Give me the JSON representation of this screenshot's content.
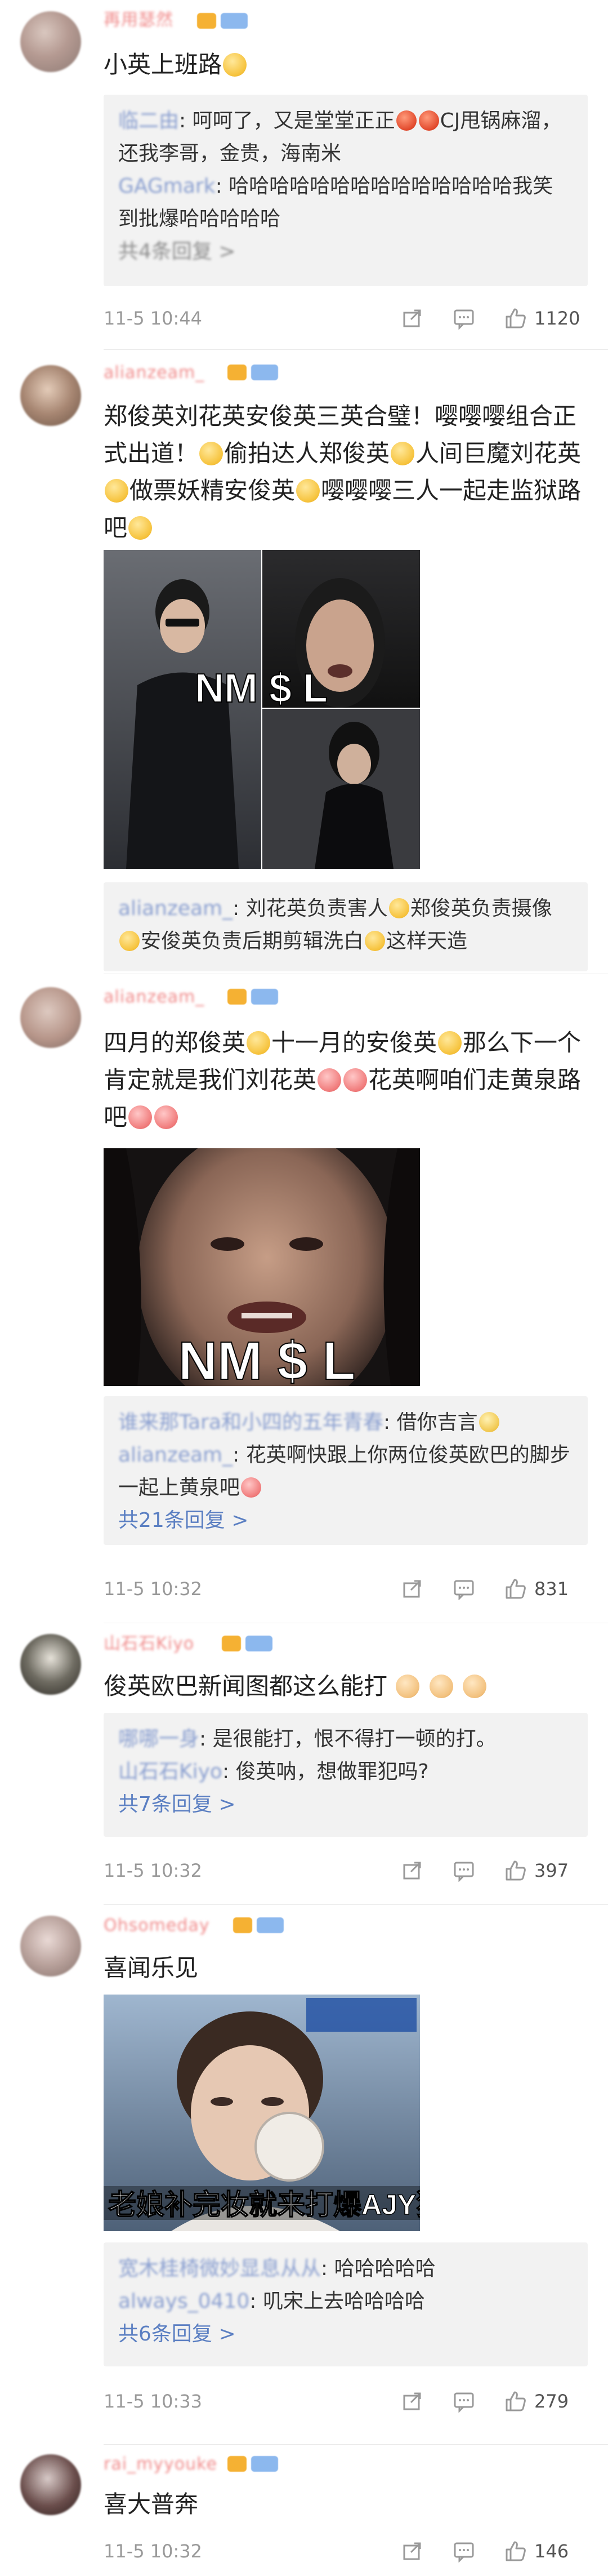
{
  "comments": [
    {
      "username": "再用瑟然",
      "text_parts": [
        "小英上班路"
      ],
      "replies": [
        {
          "name": "临二由",
          "text": ": 呵呵了，又是堂堂正正",
          "emoji": [
            "red",
            "red"
          ],
          "text2": "CJ甩锅麻溜，还我李哥，金贵，海南米"
        },
        {
          "name": "GAGmark",
          "text": ": 哈哈哈哈哈哈哈哈哈哈哈哈哈哈我笑到批爆哈哈哈哈哈"
        }
      ],
      "more_blur": "共4条回复 >",
      "time": "11-5 10:44",
      "likes": "1120"
    },
    {
      "username": "alianzeam_",
      "text": "郑俊英刘花英安俊英三英合璧！嘤嘤嘤组合正式出道！偷拍达人郑俊英人间巨魔刘花英做票妖精安俊英嘤嘤嘤三人一起走监狱路吧",
      "image_caption": "NM $ L",
      "reply": {
        "name": "alianzeam_",
        "text": ": 刘花英负责害人郑俊英负责摄像安俊英负责后期剪辑洗白这样天造"
      }
    },
    {
      "username": "alianzeam_",
      "text": "四月的郑俊英十一月的安俊英那么下一个肯定就是我们刘花英花英啊咱们走黄泉路吧",
      "image_caption": "NM $ L",
      "replies": [
        {
          "name": "谁来那Tara和小四的五年青春",
          "text": ": 借你吉言"
        },
        {
          "name": "alianzeam_",
          "text": ": 花英啊快跟上你两位俊英欧巴的脚步一起上黄泉吧"
        }
      ],
      "more": "共21条回复 >",
      "time": "11-5 10:32",
      "likes": "831"
    },
    {
      "username": "山石石Kiyo",
      "text": "俊英欧巴新闻图都这么能打",
      "replies": [
        {
          "name": "哪哪一身",
          "text": ": 是很能打，恨不得打一顿的打。"
        },
        {
          "name": "山石石Kiyo",
          "text": ": 俊英呐，想做罪犯吗?"
        }
      ],
      "more": "共7条回复 >",
      "time": "11-5 10:32",
      "likes": "397"
    },
    {
      "username": "Ohsomeday",
      "text": "喜闻乐见",
      "image_caption": "老娘补完妆就来打爆AJY狗",
      "replies": [
        {
          "name": "宽木桂椅微妙显息从从",
          "text": ": 哈哈哈哈哈"
        },
        {
          "name": "always_0410",
          "text": ": 叽宋上去哈哈哈哈"
        }
      ],
      "more": "共6条回复 >",
      "time": "11-5 10:33",
      "likes": "279"
    },
    {
      "username": "rai_myyouke",
      "text": "喜大普奔",
      "time": "11-5 10:32",
      "likes": "146"
    }
  ],
  "colors": {
    "link": "#5b7fc2",
    "username": "#f08a8a",
    "reply_bg": "#f2f2f2",
    "meta": "#999999"
  },
  "icons": [
    "share-icon",
    "comment-icon",
    "like-icon"
  ]
}
